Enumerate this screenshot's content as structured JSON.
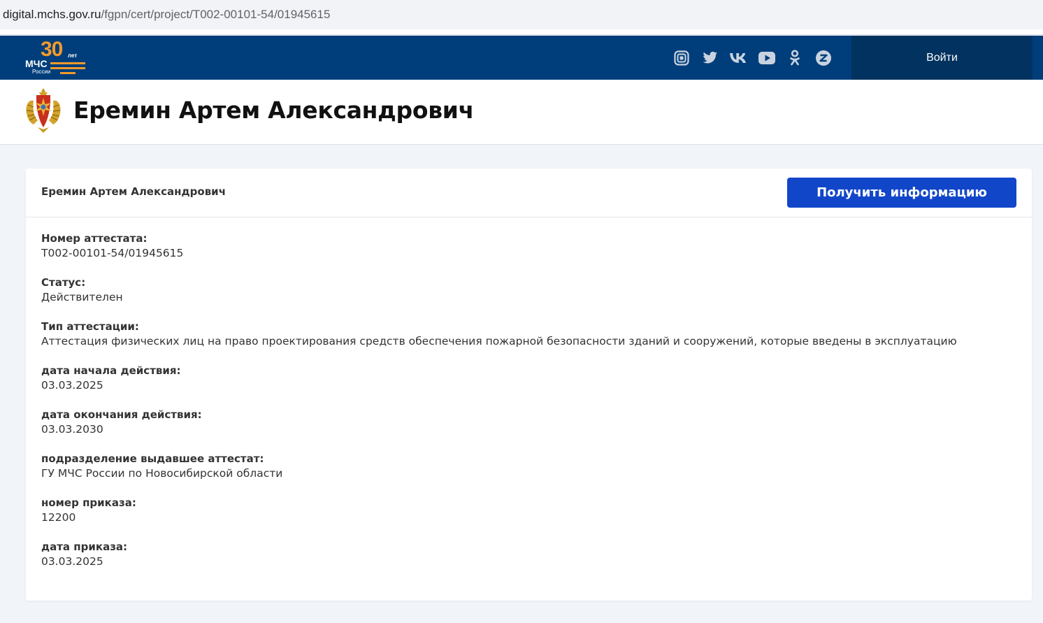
{
  "browser": {
    "url_domain": "digital.mchs.gov.ru",
    "url_path": "/fgpn/cert/project/T002-00101-54/01945615"
  },
  "header": {
    "logo": {
      "number": "30",
      "suffix": "лет",
      "org": "МЧС",
      "country": "России",
      "brand_color": "#f39a2a"
    },
    "socials": [
      {
        "icon": "rutube-icon"
      },
      {
        "icon": "twitter-icon"
      },
      {
        "icon": "vk-icon"
      },
      {
        "icon": "youtube-icon"
      },
      {
        "icon": "odnoklassniki-icon"
      },
      {
        "icon": "zen-icon"
      }
    ],
    "login_label": "Войти",
    "background_color": "#003e7b"
  },
  "page": {
    "title": "Еремин Артем Александрович"
  },
  "card": {
    "person_name": "Еремин Артем Александрович",
    "action_button": "Получить информацию",
    "button_color": "#1246c9",
    "fields": [
      {
        "label": "Номер аттестата:",
        "value": "T002-00101-54/01945615"
      },
      {
        "label": "Статус:",
        "value": "Действителен"
      },
      {
        "label": "Тип аттестации:",
        "value": "Аттестация физических лиц на право проектирования средств обеспечения пожарной безопасности зданий и сооружений, которые введены в эксплуатацию"
      },
      {
        "label": "дата начала действия:",
        "value": "03.03.2025"
      },
      {
        "label": "дата окончания действия:",
        "value": "03.03.2030"
      },
      {
        "label": "подразделение выдавшее аттестат:",
        "value": "ГУ МЧС России по Новосибирской области"
      },
      {
        "label": "номер приказа:",
        "value": "12200"
      },
      {
        "label": "дата приказа:",
        "value": "03.03.2025"
      }
    ]
  }
}
